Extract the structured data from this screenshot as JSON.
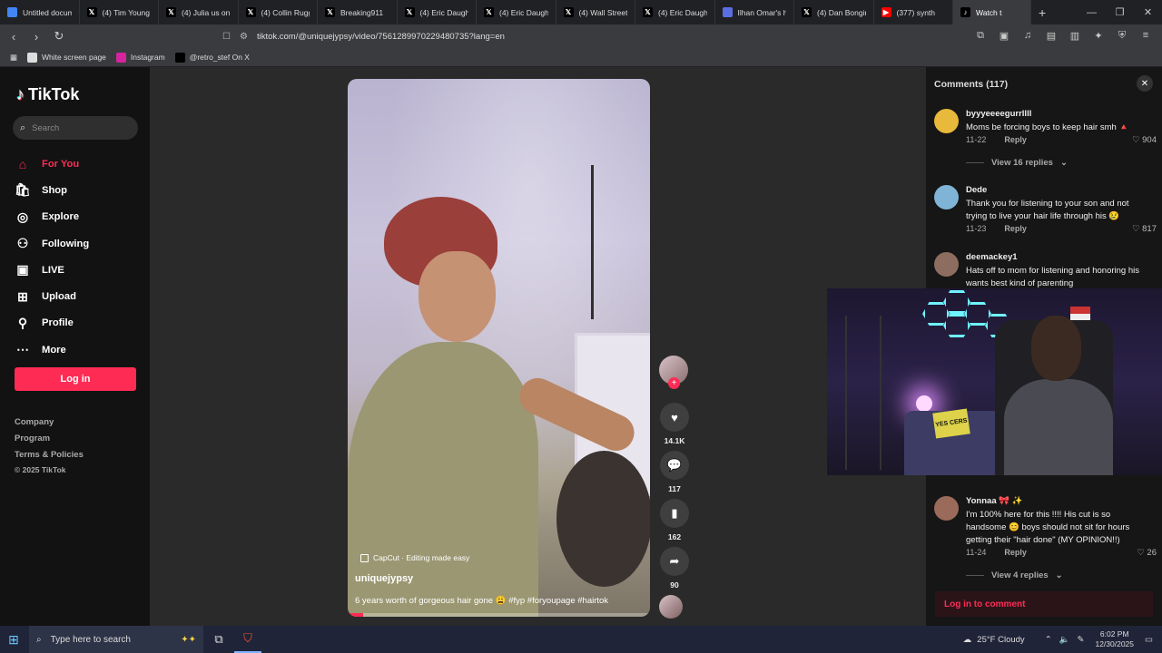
{
  "browser": {
    "tabs": [
      {
        "label": "Untitled docum",
        "icon": "docs-icon",
        "color": "#4285f4"
      },
      {
        "label": "(4) Tim Young o",
        "icon": "x-icon",
        "color": "#000000"
      },
      {
        "label": "(4) Julia us on X",
        "icon": "x-icon",
        "color": "#000000"
      },
      {
        "label": "(4) Collin Rugg",
        "icon": "x-icon",
        "color": "#000000"
      },
      {
        "label": "Breaking911",
        "icon": "x-icon",
        "color": "#000000"
      },
      {
        "label": "(4) Eric Daughe",
        "icon": "x-icon",
        "color": "#000000"
      },
      {
        "label": "(4) Eric Daughe",
        "icon": "x-icon",
        "color": "#000000"
      },
      {
        "label": "(4) Wall Street",
        "icon": "x-icon",
        "color": "#000000"
      },
      {
        "label": "(4) Eric Daughe",
        "icon": "x-icon",
        "color": "#000000"
      },
      {
        "label": "Ilhan Omar's h",
        "icon": "page-icon",
        "color": "#5b6ee1"
      },
      {
        "label": "(4) Dan Bongin",
        "icon": "x-icon",
        "color": "#000000"
      },
      {
        "label": "(377) synth",
        "icon": "youtube-icon",
        "color": "#ff0000"
      },
      {
        "label": "Watch t",
        "icon": "tiktok-icon",
        "color": "#000000"
      }
    ],
    "url": "tiktok.com/@uniquejypsy/video/7561289970229480735?lang=en",
    "bookmarks": [
      {
        "label": "White screen page",
        "color": "#dddddd"
      },
      {
        "label": "Instagram",
        "color": "#d6249f"
      },
      {
        "label": "@retro_stef On X",
        "color": "#000000"
      }
    ]
  },
  "sidebar": {
    "logo": "TikTok",
    "search_placeholder": "Search",
    "nav": [
      {
        "label": "For You",
        "icon": "home-icon",
        "active": true
      },
      {
        "label": "Shop",
        "icon": "shop-icon",
        "active": false
      },
      {
        "label": "Explore",
        "icon": "compass-icon",
        "active": false
      },
      {
        "label": "Following",
        "icon": "following-icon",
        "active": false
      },
      {
        "label": "LIVE",
        "icon": "live-icon",
        "active": false
      },
      {
        "label": "Upload",
        "icon": "upload-icon",
        "active": false
      },
      {
        "label": "Profile",
        "icon": "profile-icon",
        "active": false
      },
      {
        "label": "More",
        "icon": "more-icon",
        "active": false
      }
    ],
    "login": "Log in",
    "footer": [
      "Company",
      "Program",
      "Terms & Policies",
      "© 2025 TikTok"
    ]
  },
  "video": {
    "capcut": "CapCut · Editing made easy",
    "username": "uniquejypsy",
    "description": "6 years worth of gorgeous hair gone 😩 #fyp #foryoupage #hairtok",
    "progress": 0.05,
    "likes": "14.1K",
    "comments": "117",
    "saves": "162",
    "shares": "90"
  },
  "comments": {
    "title": "Comments (117)",
    "items": [
      {
        "name": "byyyeeeegurrllll",
        "text": "Moms be forcing boys to keep hair smh 🔺",
        "date": "11-22",
        "reply": "Reply",
        "likes": "904",
        "view": "View 16 replies",
        "avatar_color": "#e8b93a"
      },
      {
        "name": "Dede",
        "text": "Thank you for listening to your son and not trying to live your hair life through his 😢",
        "date": "11-23",
        "reply": "Reply",
        "likes": "817",
        "view": "",
        "avatar_color": "#7fb4d6"
      },
      {
        "name": "deemackey1",
        "text": "Hats off to mom for listening and honoring his wants best kind of parenting",
        "date": "",
        "reply": "",
        "likes": "",
        "view": "",
        "avatar_color": "#8c6d60"
      },
      {
        "name": "Yonnaa 🎀 ✨",
        "text": "I'm 100% here for this !!!! His cut is so handsome 😊 boys should not sit for hours getting their \"hair done\" (MY OPINION!!)",
        "date": "11-24",
        "reply": "Reply",
        "likes": "26",
        "view": "View 4 replies",
        "avatar_color": "#9a6a5a"
      }
    ],
    "login_prompt": "Log in to comment"
  },
  "webcam": {
    "pillow_text": "YES CERS"
  },
  "taskbar": {
    "search_placeholder": "Type here to search",
    "weather": "25°F  Cloudy",
    "time": "6:02 PM",
    "date": "12/30/2025"
  }
}
